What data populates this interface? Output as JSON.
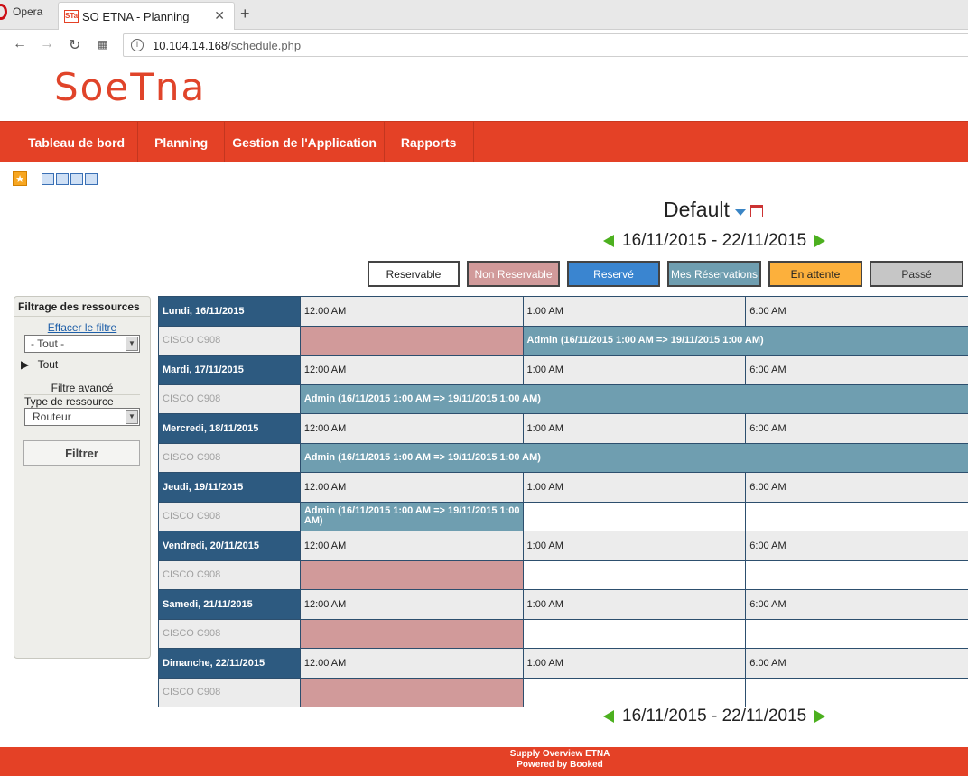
{
  "browser": {
    "opera_label": "Opera",
    "tab_title": "SO ETNA - Planning",
    "favicon_text": "STa",
    "tab_close": "✕",
    "new_tab": "+",
    "back": "←",
    "forward": "→",
    "reload": "↻",
    "url_icon": "i",
    "url_host": "10.104.14.168",
    "url_path": "/schedule.php"
  },
  "logo": "SoeTna",
  "nav": [
    "Tableau de bord",
    "Planning",
    "Gestion de l'Application",
    "Rapports"
  ],
  "schedule": {
    "title": "Default",
    "daterange": "16/11/2015 - 22/11/2015"
  },
  "legend": [
    {
      "label": "Reservable",
      "bg": "#ffffff",
      "color": "#222222"
    },
    {
      "label": "Non Reservable",
      "bg": "#d19a9a",
      "color": "#ffffff"
    },
    {
      "label": "Reservé",
      "bg": "#3a85d0",
      "color": "#ffffff"
    },
    {
      "label": "Mes Réservations",
      "bg": "#6f9eb0",
      "color": "#ffffff"
    },
    {
      "label": "En attente",
      "bg": "#fcb03c",
      "color": "#222222"
    },
    {
      "label": "Passé",
      "bg": "#c6c6c6",
      "color": "#333333"
    }
  ],
  "sidebar": {
    "title": "Filtrage des ressources",
    "clear_link": "Effacer le filtre",
    "select_all": "- Tout -",
    "tree_item": "Tout",
    "advanced": "Filtre avancé",
    "type_label": "Type de ressource",
    "type_value": "Routeur",
    "filter_button": "Filtrer"
  },
  "times": [
    "12:00 AM",
    "1:00 AM",
    "6:00 AM"
  ],
  "resource": "CISCO C908",
  "days": [
    {
      "label": "Lundi, 16/11/2015",
      "cells": [
        "nonres",
        "booked2",
        "booked2span"
      ],
      "booking": "Admin (16/11/2015 1:00 AM => 19/11/2015 1:00 AM)"
    },
    {
      "label": "Mardi, 17/11/2015",
      "cells": [
        "full"
      ],
      "booking": "Admin (16/11/2015 1:00 AM => 19/11/2015 1:00 AM)"
    },
    {
      "label": "Mercredi, 18/11/2015",
      "cells": [
        "full"
      ],
      "booking": "Admin (16/11/2015 1:00 AM => 19/11/2015 1:00 AM)"
    },
    {
      "label": "Jeudi, 19/11/2015",
      "cells": [
        "booked",
        "empty",
        "empty"
      ],
      "booking": "Admin (16/11/2015 1:00 AM => 19/11/2015 1:00 AM)"
    },
    {
      "label": "Vendredi, 20/11/2015",
      "cells": [
        "nonres",
        "empty",
        "empty"
      ],
      "booking": ""
    },
    {
      "label": "Samedi, 21/11/2015",
      "cells": [
        "nonres",
        "empty",
        "empty"
      ],
      "booking": ""
    },
    {
      "label": "Dimanche, 22/11/2015",
      "cells": [
        "nonres",
        "empty",
        "empty"
      ],
      "booking": ""
    }
  ],
  "footer": {
    "line1": "Supply Overview ETNA",
    "line2": "Powered by Booked"
  }
}
